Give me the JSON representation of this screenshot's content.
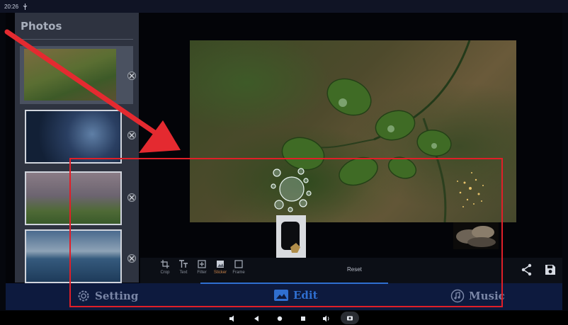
{
  "status_bar": {
    "time": "20:26",
    "usb_icon": "usb-icon"
  },
  "sidebar": {
    "title": "Photos",
    "photos": [
      {
        "name": "fern-leaves-photo",
        "selected": true
      },
      {
        "name": "blue-rocks-photo",
        "selected": false
      },
      {
        "name": "field-haze-photo",
        "selected": false
      },
      {
        "name": "lake-sunset-photo",
        "selected": false
      }
    ]
  },
  "tools": [
    {
      "label": "Crop",
      "icon": "crop-icon"
    },
    {
      "label": "Text",
      "icon": "text-icon"
    },
    {
      "label": "Filter",
      "icon": "filter-icon"
    },
    {
      "label": "Sticker",
      "icon": "sticker-icon",
      "active": true
    },
    {
      "label": "Frame",
      "icon": "frame-icon"
    }
  ],
  "reset_label": "Reset",
  "bottom_nav": {
    "setting": "Setting",
    "edit": "Edit",
    "music": "Music"
  },
  "colors": {
    "accent": "#2f6fd0",
    "annotation": "#e01f28",
    "sticker_active": "#c9834a"
  }
}
